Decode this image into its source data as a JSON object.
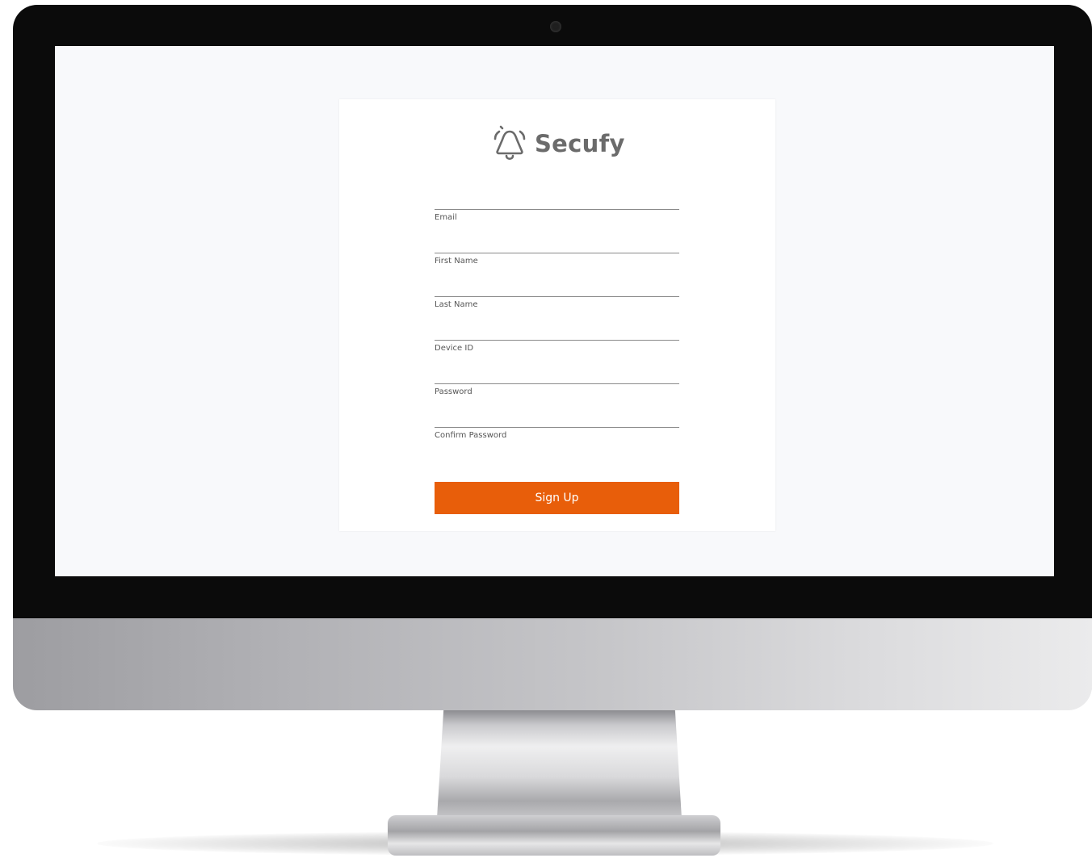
{
  "app": {
    "brand_name": "Secufy",
    "brand_icon": "bell-alert-icon",
    "accent_color": "#e85e0a"
  },
  "form": {
    "fields": [
      {
        "label": "Email",
        "value": ""
      },
      {
        "label": "First Name",
        "value": ""
      },
      {
        "label": "Last Name",
        "value": ""
      },
      {
        "label": "Device ID",
        "value": ""
      },
      {
        "label": "Password",
        "value": ""
      },
      {
        "label": "Confirm Password",
        "value": ""
      }
    ],
    "submit_label": "Sign Up"
  }
}
